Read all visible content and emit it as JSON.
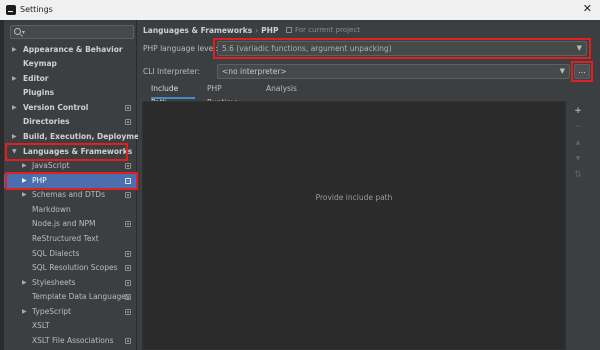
{
  "window": {
    "title": "Settings",
    "close_glyph": "✕"
  },
  "search": {
    "placeholder": ""
  },
  "sidebar": {
    "items": [
      {
        "label": "Appearance & Behavior",
        "arrow": "▶",
        "bold": true
      },
      {
        "label": "Keymap",
        "bold": true
      },
      {
        "label": "Editor",
        "arrow": "▶",
        "bold": true
      },
      {
        "label": "Plugins",
        "bold": true
      },
      {
        "label": "Version Control",
        "arrow": "▶",
        "bold": true,
        "project": true
      },
      {
        "label": "Directories",
        "bold": true,
        "project": true
      },
      {
        "label": "Build, Execution, Deployment",
        "arrow": "▶",
        "bold": true
      },
      {
        "label": "Languages & Frameworks",
        "arrow": "▼",
        "bold": true
      },
      {
        "label": "JavaScript",
        "arrow": "▶",
        "project": true
      },
      {
        "label": "PHP",
        "arrow": "▶",
        "project": true,
        "selected": true
      },
      {
        "label": "Schemas and DTDs",
        "arrow": "▶",
        "project": true
      },
      {
        "label": "Markdown"
      },
      {
        "label": "Node.js and NPM",
        "project": true
      },
      {
        "label": "ReStructured Text"
      },
      {
        "label": "SQL Dialects",
        "project": true
      },
      {
        "label": "SQL Resolution Scopes",
        "project": true
      },
      {
        "label": "Stylesheets",
        "arrow": "▶",
        "project": true
      },
      {
        "label": "Template Data Languages",
        "project": true
      },
      {
        "label": "TypeScript",
        "arrow": "▶",
        "project": true
      },
      {
        "label": "XSLT"
      },
      {
        "label": "XSLT File Associations",
        "project": true
      }
    ]
  },
  "main": {
    "breadcrumb": {
      "parent": "Languages & Frameworks",
      "separator": "›",
      "current": "PHP"
    },
    "scope_note": "For current project",
    "language_level": {
      "label": "PHP language level:",
      "value": "5.6 (variadic functions, argument unpacking)"
    },
    "cli": {
      "label": "CLI Interpreter:",
      "value": "<no interpreter>",
      "browse": "..."
    },
    "tabs": [
      {
        "label": "Include Path",
        "active": true
      },
      {
        "label": "PHP Runtime"
      },
      {
        "label": "Analysis"
      }
    ],
    "include_path_empty": "Provide include path",
    "tools": [
      {
        "glyph": "+",
        "name": "add-icon",
        "enabled": true
      },
      {
        "glyph": "−",
        "name": "remove-icon",
        "enabled": false
      },
      {
        "glyph": "▲",
        "name": "move-up-icon",
        "enabled": false
      },
      {
        "glyph": "▼",
        "name": "move-down-icon",
        "enabled": false
      },
      {
        "glyph": "⇅",
        "name": "sort-icon",
        "enabled": false
      }
    ]
  },
  "colors": {
    "accent": "#4b6eaf",
    "highlight": "#e02020",
    "background": "#3c3f41"
  }
}
